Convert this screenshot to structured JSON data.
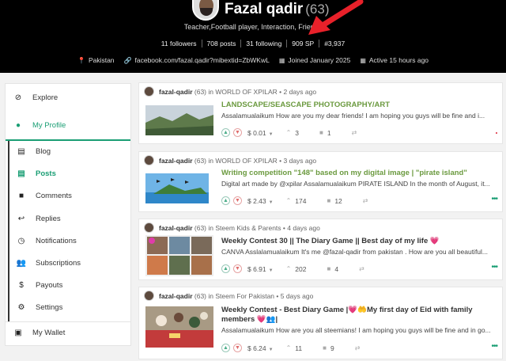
{
  "profile": {
    "name": "Fazal qadir",
    "reputation": "(63)",
    "about": "Teacher,Football player, Interaction, Friends",
    "stats": [
      "11 followers",
      "708 posts",
      "31 following",
      "909 SP",
      "#3,937"
    ],
    "meta": {
      "location": "Pakistan",
      "website": "facebook.com/fazal.qadir?mibextid=ZbWKwL",
      "joined": "Joined January 2025",
      "active": "Active 15 hours ago"
    }
  },
  "sidebar": {
    "items": [
      {
        "label": "Explore",
        "icon": "compass-icon"
      },
      {
        "label": "My Profile",
        "icon": "user-icon"
      },
      {
        "label": "Blog",
        "icon": "book-icon"
      },
      {
        "label": "Posts",
        "icon": "posts-icon"
      },
      {
        "label": "Comments",
        "icon": "comment-icon"
      },
      {
        "label": "Replies",
        "icon": "reply-icon"
      },
      {
        "label": "Notifications",
        "icon": "clock-icon"
      },
      {
        "label": "Subscriptions",
        "icon": "users-icon"
      },
      {
        "label": "Payouts",
        "icon": "dollar-icon"
      },
      {
        "label": "Settings",
        "icon": "gear-icon"
      },
      {
        "label": "My Wallet",
        "icon": "wallet-icon"
      }
    ],
    "accent": "#1a9e74"
  },
  "posts": [
    {
      "author": "fazal-qadir",
      "rep": "(63)",
      "in": "in",
      "community": "WORLD OF XPILAR",
      "time": "• 2 days ago",
      "title": "LANDSCAPE/SEASCAPE PHOTOGRAPHY/ART",
      "excerpt": "Assalamualaikum How are you my dear friends! I am hoping you guys will be fine and i...",
      "payout": "$ 0.01",
      "votes": "3",
      "comments": "1"
    },
    {
      "author": "fazal-qadir",
      "rep": "(63)",
      "in": "in",
      "community": "WORLD OF XPILAR",
      "time": "• 3 days ago",
      "title": "Writing competition \"148\" based on my digital image | \"pirate island\"",
      "excerpt": "Digital art made by @xpilar Assalamualaikum PIRATE ISLAND In the month of August, it...",
      "payout": "$ 2.43",
      "votes": "174",
      "comments": "12"
    },
    {
      "author": "fazal-qadir",
      "rep": "(63)",
      "in": "in",
      "community": "Steem Kids & Parents",
      "time": "• 4 days ago",
      "title": "Weekly Contest 30 || The Diary Game || Best day of my life 💗",
      "excerpt": "CANVA Asslalamualaikum It's me @fazal-qadir from pakistan . How are you all beautiful...",
      "payout": "$ 6.91",
      "votes": "202",
      "comments": "4"
    },
    {
      "author": "fazal-qadir",
      "rep": "(63)",
      "in": "in",
      "community": "Steem For Pakistan",
      "time": "• 5 days ago",
      "title": "Weekly Contest - Best Diary Game |💗🤲My first day of Eid with family members 💗👥|",
      "excerpt": "Assalamualaikum How are you all steemians! I am hoping you guys will be fine and in go...",
      "payout": "$ 6.24",
      "votes": "11",
      "comments": "9"
    }
  ]
}
